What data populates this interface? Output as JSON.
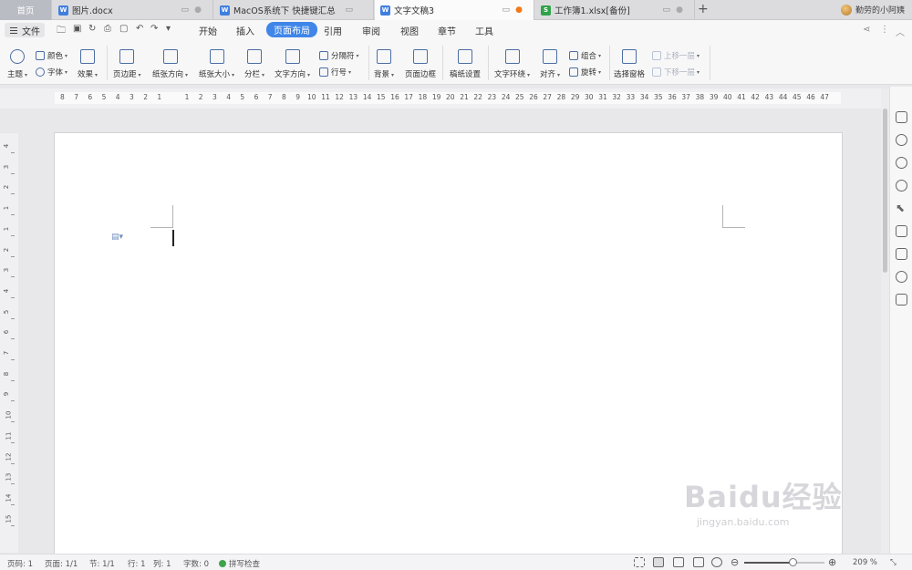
{
  "tabs": {
    "home": "首页",
    "items": [
      {
        "title": "图片.docx",
        "icon_color": "#3f7fe0",
        "icon_letter": "W"
      },
      {
        "title": "MacOS系统下 快捷键汇总",
        "icon_color": "#3f7fe0",
        "icon_letter": "W"
      },
      {
        "title": "文字文稿3",
        "icon_color": "#3f7fe0",
        "icon_letter": "W"
      },
      {
        "title": "工作簿1.xlsx[备份]",
        "icon_color": "#2fa24a",
        "icon_letter": "S"
      }
    ],
    "add": "+",
    "user": "勤劳的小阿姨"
  },
  "menu": {
    "file": "文件",
    "tabs": [
      "开始",
      "插入",
      "页面布局",
      "引用",
      "审阅",
      "视图",
      "章节",
      "工具"
    ],
    "active": "页面布局"
  },
  "ribbon": {
    "theme": "主题",
    "color": "颜色",
    "font": "字体",
    "effect": "效果",
    "margins": "页边距",
    "orientation": "纸张方向",
    "size": "纸张大小",
    "columns": "分栏",
    "text_direction": "文字方向",
    "breaks": "分隔符",
    "line_numbers": "行号",
    "background": "背景",
    "page_border": "页面边框",
    "manuscript": "稿纸设置",
    "text_wrap": "文字环绕",
    "align": "对齐",
    "group": "组合",
    "rotate": "旋转",
    "selection_pane": "选择窗格",
    "bring_forward": "上移一层",
    "send_backward": "下移一层",
    "accent_color": "#3f86e8"
  },
  "ruler": {
    "left_numbers": [
      "8",
      "7",
      "6",
      "5",
      "4",
      "3",
      "2",
      "1"
    ],
    "right_numbers": [
      "1",
      "2",
      "3",
      "4",
      "5",
      "6",
      "7",
      "8",
      "9",
      "10",
      "11",
      "12",
      "13",
      "14",
      "15",
      "16",
      "17",
      "18",
      "19",
      "20",
      "21",
      "22",
      "23",
      "24",
      "25",
      "26",
      "27",
      "28",
      "29",
      "30",
      "31",
      "32",
      "33",
      "34",
      "35",
      "36",
      "37",
      "38",
      "39",
      "40",
      "41",
      "42",
      "43",
      "44",
      "45",
      "46",
      "47"
    ],
    "vertical_numbers": [
      "4",
      "3",
      "2",
      "1",
      "1",
      "2",
      "3",
      "4",
      "5",
      "6",
      "7",
      "8",
      "9",
      "10",
      "11",
      "12",
      "13",
      "14",
      "15"
    ]
  },
  "status": {
    "page_code": "页码: 1",
    "page": "页面: 1/1",
    "section": "节: 1/1",
    "row": "行: 1",
    "col": "列: 1",
    "word_count": "字数: 0",
    "spell_check": "拼写检查",
    "zoom": "209 %",
    "zoom_fraction": 0.6
  },
  "watermark": {
    "main": "Baidu经验",
    "sub": "jingyan.baidu.com"
  }
}
